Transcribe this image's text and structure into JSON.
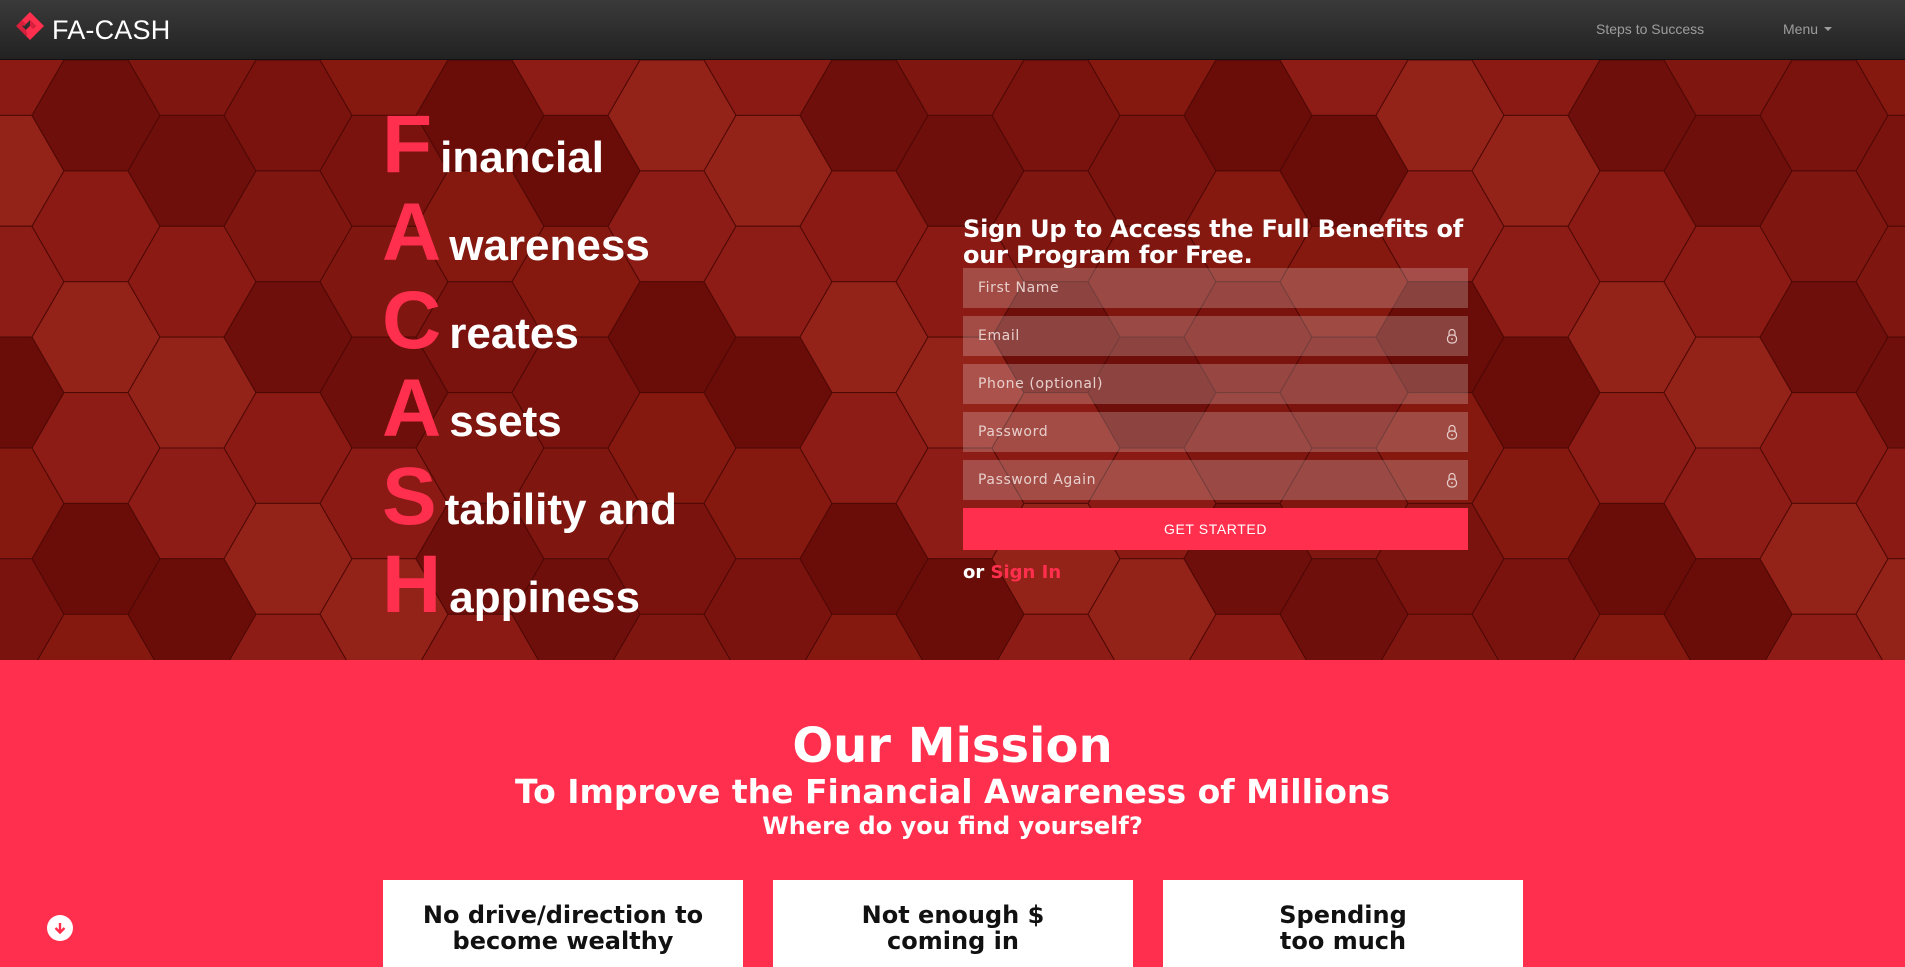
{
  "navbar": {
    "brand": "FA-CASH",
    "steps_label": "Steps to Success",
    "menu_label": "Menu"
  },
  "hero": {
    "acrostic": [
      {
        "letter": "F",
        "rest": "inancial"
      },
      {
        "letter": "A",
        "rest": "wareness"
      },
      {
        "letter": "C",
        "rest": "reates"
      },
      {
        "letter": "A",
        "rest": "ssets"
      },
      {
        "letter": "S",
        "rest": "tability and"
      },
      {
        "letter": "H",
        "rest": "appiness"
      }
    ],
    "signup": {
      "title": "Sign Up to Access the Full Benefits of our Program for Free.",
      "first_name_placeholder": "First Name",
      "email_placeholder": "Email",
      "phone_placeholder": "Phone (optional)",
      "password_placeholder": "Password",
      "password_again_placeholder": "Password Again",
      "submit_label": "GET STARTED",
      "or_label": "or",
      "signin_label": "Sign In"
    }
  },
  "mission": {
    "title": "Our Mission",
    "subtitle": "To Improve the Financial Awareness of Millions",
    "question": "Where do you find yourself?",
    "cards": [
      {
        "line1": "No drive/direction to",
        "line2": "become wealthy"
      },
      {
        "line1": "Not enough $",
        "line2": "coming in"
      },
      {
        "line1": "Spending",
        "line2": "too much"
      }
    ]
  },
  "colors": {
    "accent": "#ff2f4d",
    "hero_bg": "#7e1510",
    "navbar_bg": "#2b2b2b"
  }
}
